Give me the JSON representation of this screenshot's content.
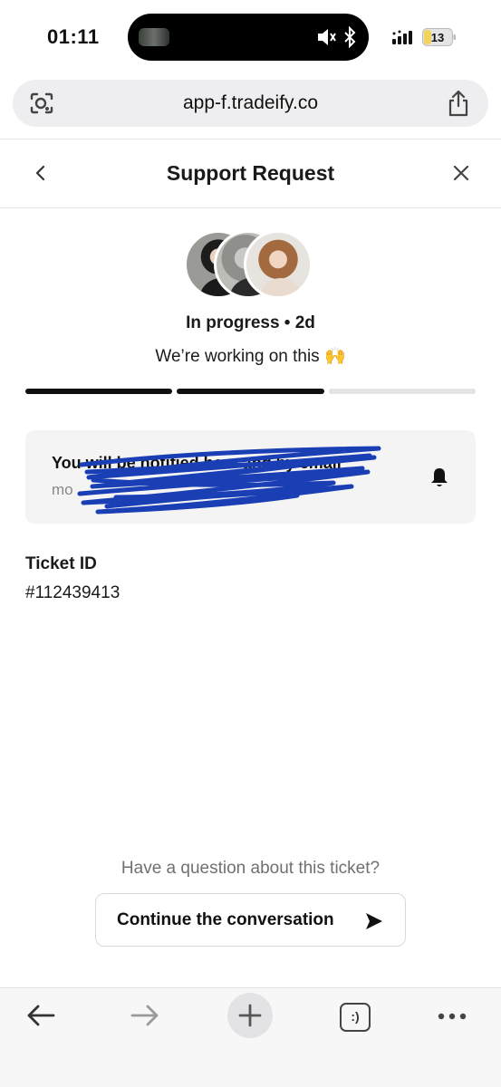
{
  "status_bar": {
    "time": "01:11",
    "battery": "13",
    "battery_color": "#f2d45c"
  },
  "browser": {
    "url": "app-f.tradeify.co",
    "icons": [
      "lens-icon",
      "share-icon"
    ]
  },
  "header": {
    "title": "Support Request",
    "back_icon": "chevron-left-icon",
    "close_icon": "close-icon"
  },
  "ticket": {
    "status": "In progress • 2d",
    "message": "We’re working on this 🙌",
    "progress": {
      "segments_total": 3,
      "segments_complete": 2
    },
    "label": "Ticket ID",
    "id": "#112439413"
  },
  "notice": {
    "title": "You will be notified here and by email",
    "subtitle": "mo",
    "icon": "bell-icon",
    "redaction_color": "#1a3fb5"
  },
  "cta": {
    "question": "Have a question about this ticket?",
    "button_label": "Continue the conversation",
    "icon": "send-icon"
  },
  "toolbar": {
    "tabs_label": ":)",
    "icons": [
      "back-arrow-icon",
      "forward-arrow-icon",
      "plus-icon",
      "tabs-icon",
      "more-icon"
    ]
  }
}
